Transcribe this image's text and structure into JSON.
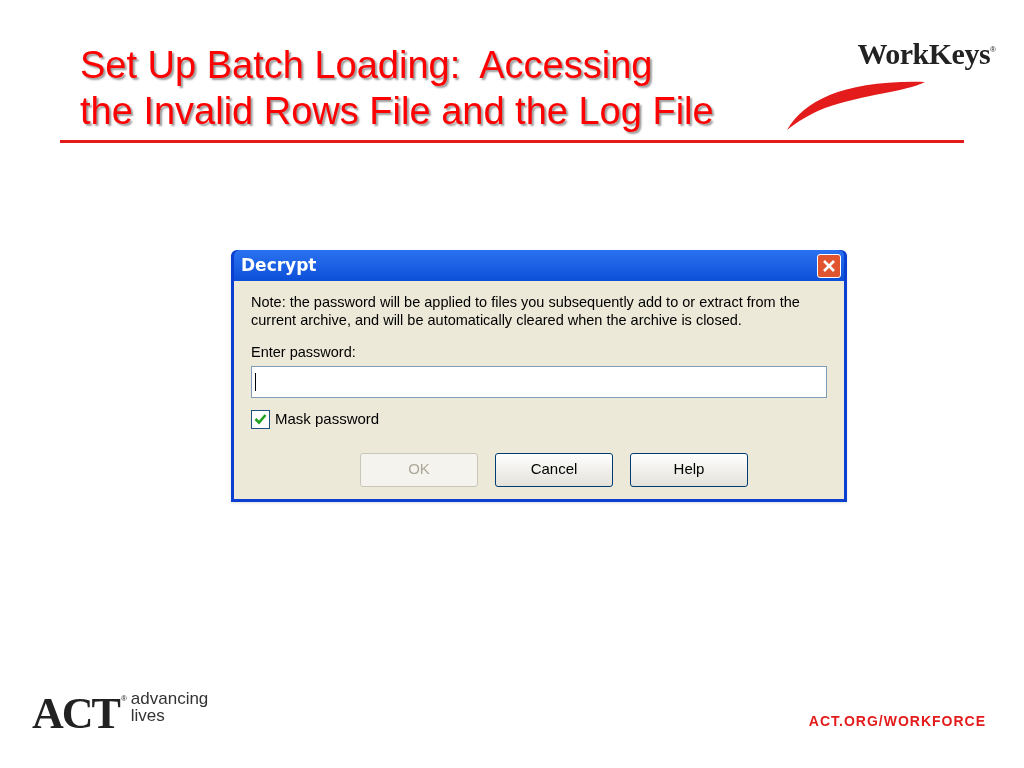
{
  "slide": {
    "title_lines": [
      "Set Up Batch Loading:  Accessing",
      "the Invalid Rows File and the Log File"
    ],
    "brand": {
      "name": "WorkKeys",
      "mark": "®"
    }
  },
  "dialog": {
    "title": "Decrypt",
    "note": "Note: the password will be applied to files you subsequently add to or extract from the current archive, and will be automatically cleared when the archive is closed.",
    "field_label": "Enter password:",
    "mask_password": {
      "label": "Mask password",
      "checked": true
    },
    "buttons": [
      {
        "label": "OK",
        "disabled": true
      },
      {
        "label": "Cancel",
        "disabled": false
      },
      {
        "label": "Help",
        "disabled": false
      }
    ]
  },
  "footer": {
    "logo": {
      "name": "ACT",
      "mark": "®",
      "tagline_lines": [
        "advancing",
        "lives"
      ]
    },
    "url": "ACT.ORG/WORKFORCE"
  }
}
